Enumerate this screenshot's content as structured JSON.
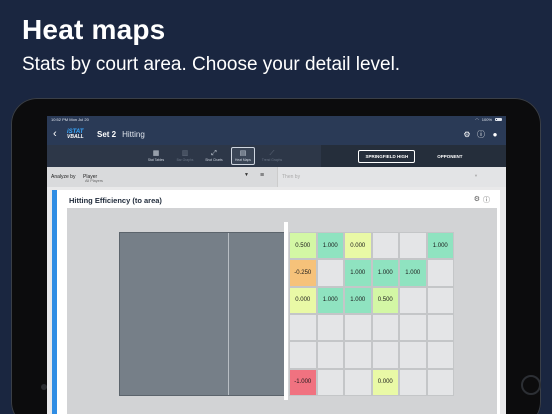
{
  "promo": {
    "title": "Heat maps",
    "subtitle": "Stats by court area. Choose your detail level."
  },
  "statusbar": {
    "time": "10:52 PM  Mon Jul 20",
    "battery": "100%"
  },
  "appbar": {
    "logo_top": "iSTAT",
    "logo_bottom": "VBALL",
    "set": "Set 2",
    "skill": "Hitting",
    "icons": [
      "back-icon",
      "gear-icon",
      "help-icon",
      "user-icon"
    ]
  },
  "toolbar": {
    "tools": [
      {
        "label": "Stat Tables",
        "icon": "table-icon",
        "state": "normal"
      },
      {
        "label": "Bar Graphs",
        "icon": "bar-graph-icon",
        "state": "dim"
      },
      {
        "label": "Shot Charts",
        "icon": "shot-chart-icon",
        "state": "normal"
      },
      {
        "label": "Heat Maps",
        "icon": "heat-map-icon",
        "state": "active"
      },
      {
        "label": "Trend Graphs",
        "icon": "trend-graph-icon",
        "state": "dim"
      }
    ],
    "teams": [
      {
        "label": "SPRINGFIELD HIGH",
        "selected": true
      },
      {
        "label": "OPPONENT",
        "selected": false
      }
    ]
  },
  "filters": {
    "analyze_label": "Analyze by",
    "analyze_value": "Player",
    "analyze_sub": "All Players",
    "thenby_label": "Then by"
  },
  "card": {
    "title": "Hitting Efficiency (to area)"
  },
  "heatmap": {
    "rows": 6,
    "cols": 6,
    "cells": [
      [
        "0.500",
        "1.000",
        "0.000",
        "",
        "",
        "1.000"
      ],
      [
        "-0.250",
        "",
        "1.000",
        "1.000",
        "1.000",
        ""
      ],
      [
        "0.000",
        "1.000",
        "1.000",
        "0.500",
        "",
        ""
      ],
      [
        "",
        "",
        "",
        "",
        "",
        ""
      ],
      [
        "",
        "",
        "",
        "",
        "",
        ""
      ],
      [
        "-1.000",
        "",
        "",
        "0.000",
        "",
        ""
      ]
    ],
    "colors": {
      "1.000": "#8fe3c0",
      "0.500": "#d3f7a5",
      "0.000": "#e9f9a6",
      "-0.250": "#f6c27a",
      "-1.000": "#f07280",
      "empty": "#e4e5e7"
    }
  }
}
